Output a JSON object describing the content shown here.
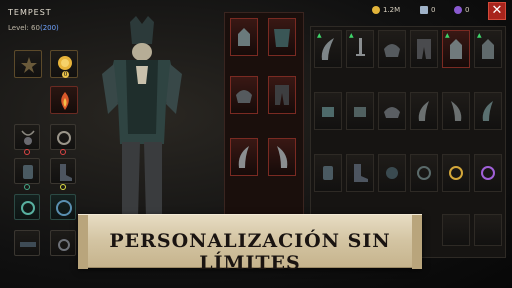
{
  "character": {
    "name": "TEMPEST",
    "level_prefix": "Level: 60",
    "level_current": "(200)",
    "slot_badge_value": "0"
  },
  "currency": {
    "gold": "1.2M",
    "scrolls": "0",
    "gems": "0"
  },
  "banner": {
    "text": "PERSONALIZACIÓN SIN LÍMITES"
  },
  "colors": {
    "banner_bg": "#d3c4a2",
    "close_button": "#a8241c",
    "level_accent": "#6fa3ff",
    "upgrade_arrow": "#3fd56a"
  }
}
